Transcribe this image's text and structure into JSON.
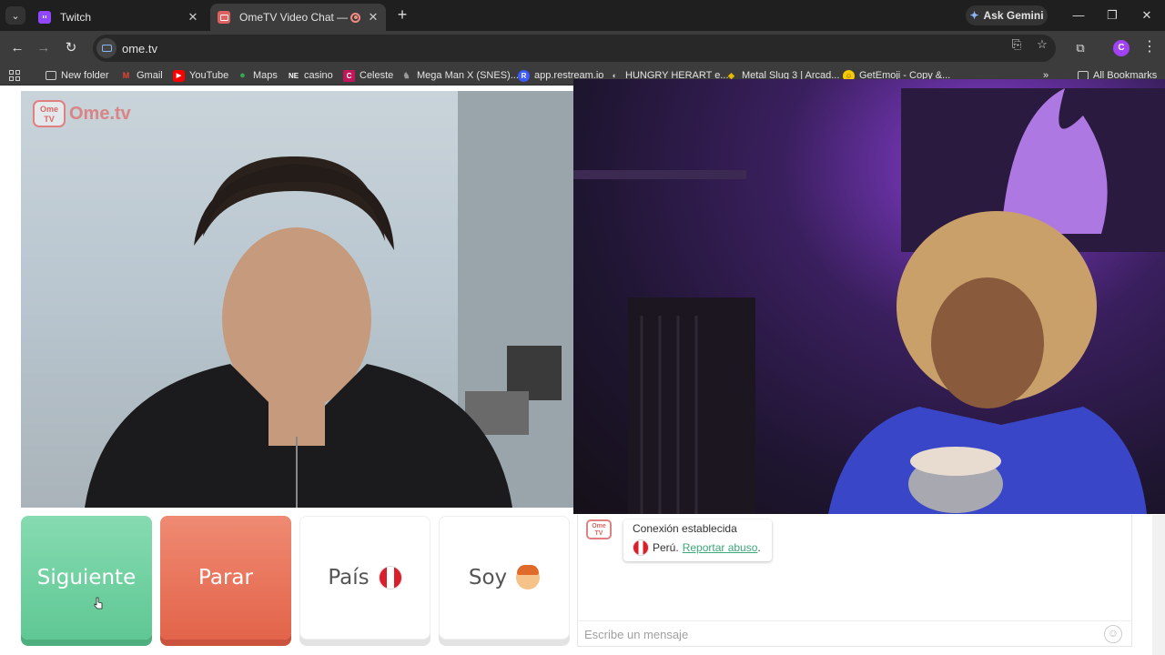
{
  "browser": {
    "tabs": [
      {
        "title": "Twitch",
        "active": false
      },
      {
        "title": "OmeTV Video Chat — Ome",
        "active": true
      }
    ],
    "ask_gemini": "Ask Gemini",
    "url": "ome.tv",
    "profile_initial": "C",
    "bookmarks": [
      "New folder",
      "Gmail",
      "YouTube",
      "Maps",
      "casino",
      "Celeste",
      "Mega Man X (SNES)...",
      "app.restream.io",
      "HUNGRY HERART e...",
      "Metal Slug 3 | Arcad...",
      "GetEmoji - Copy &...",
      "All Bookmarks"
    ]
  },
  "site": {
    "logo_small": "Ome TV",
    "logo_text": "Ome.tv"
  },
  "controls": {
    "next_label": "Siguiente",
    "stop_label": "Parar",
    "country_label": "País",
    "gender_label": "Soy"
  },
  "chat": {
    "status_title": "Conexión establecida",
    "country": "Perú.",
    "report_link": "Reportar abuso",
    "report_suffix": ".",
    "placeholder": "Escribe un mensaje"
  },
  "colors": {
    "next_green": "#5fc794",
    "stop_red": "#e2644a",
    "link_green": "#3aa877",
    "brand_pink": "#d98585"
  }
}
